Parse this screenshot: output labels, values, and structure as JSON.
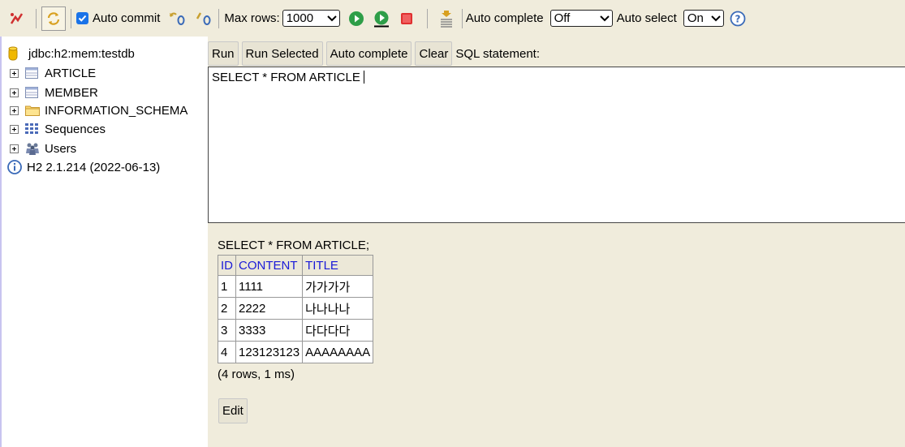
{
  "toolbar": {
    "auto_commit_label": "Auto commit",
    "max_rows_label": "Max rows:",
    "max_rows_value": "1000",
    "auto_complete_label": "Auto complete",
    "auto_complete_value": "Off",
    "auto_select_label": "Auto select",
    "auto_select_value": "On"
  },
  "tree": {
    "connection": "jdbc:h2:mem:testdb",
    "items": [
      {
        "label": "ARTICLE",
        "icon": "table-icon"
      },
      {
        "label": "MEMBER",
        "icon": "table-icon"
      },
      {
        "label": "INFORMATION_SCHEMA",
        "icon": "folder-icon"
      },
      {
        "label": "Sequences",
        "icon": "sequences-icon"
      },
      {
        "label": "Users",
        "icon": "users-icon"
      }
    ],
    "version": "H2 2.1.214 (2022-06-13)"
  },
  "sql_buttons": {
    "run": "Run",
    "run_selected": "Run Selected",
    "auto_complete": "Auto complete",
    "clear": "Clear",
    "statement_label": "SQL statement:"
  },
  "editor": {
    "text": "SELECT * FROM ARTICLE"
  },
  "result": {
    "query": "SELECT * FROM ARTICLE;",
    "columns": [
      "ID",
      "CONTENT",
      "TITLE"
    ],
    "rows": [
      [
        "1",
        "1111",
        "가가가가"
      ],
      [
        "2",
        "2222",
        "나나나나"
      ],
      [
        "3",
        "3333",
        "다다다다"
      ],
      [
        "4",
        "123123123",
        "AAAAAAAA"
      ]
    ],
    "info": "(4 rows, 1 ms)",
    "edit_label": "Edit"
  },
  "colors": {
    "panel_bg": "#f0ecdc",
    "header_text": "#1a1ad8",
    "checkbox": "#1a73e8",
    "run_green": "#2e9e48",
    "stop_red": "#e03030"
  }
}
